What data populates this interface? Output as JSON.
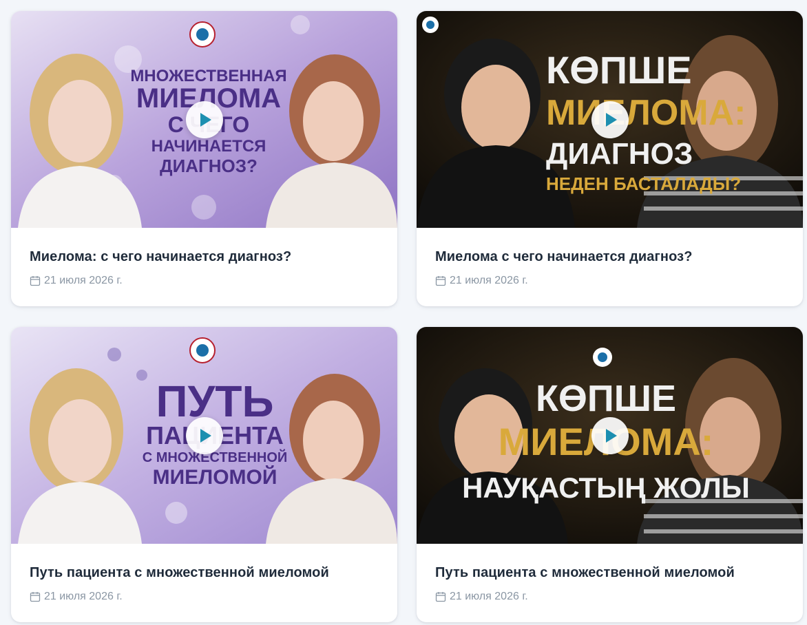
{
  "cards": [
    {
      "title": "Миелома: с чего начинается диагноз?",
      "date": "21 июля 2026 г.",
      "thumb_lines": [
        "МНОЖЕСТВЕННАЯ",
        "МИЕЛОМА",
        "С ЧЕГО",
        "НАЧИНАЕТСЯ",
        "ДИАГНОЗ?"
      ]
    },
    {
      "title": "Миелома с чего начинается диагноз?",
      "date": "21 июля 2026 г.",
      "thumb_lines": [
        "КӨПШЕ",
        "МИЕЛОМА:",
        "ДИАГНОЗ",
        "НЕДЕН БАСТАЛАДЫ?"
      ]
    },
    {
      "title": "Путь пациента с множественной миеломой",
      "date": "21 июля 2026 г.",
      "thumb_lines": [
        "ПУТЬ",
        "ПАЦИЕНТА",
        "С МНОЖЕСТВЕННОЙ",
        "МИЕЛОМОЙ"
      ]
    },
    {
      "title": "Путь пациента с множественной миеломой",
      "date": "21 июля 2026 г.",
      "thumb_lines": [
        "КӨПШЕ",
        "МИЕЛОМА:",
        "НАУҚАСТЫҢ ЖОЛЫ"
      ]
    }
  ],
  "icons": {
    "play": "play-icon",
    "calendar": "calendar-icon",
    "logo": "organization-logo-icon"
  },
  "colors": {
    "play_accent": "#1d8fb0",
    "title_text": "#1f2b3a",
    "meta_text": "#8a96a3",
    "page_bg": "#f3f6fa"
  }
}
